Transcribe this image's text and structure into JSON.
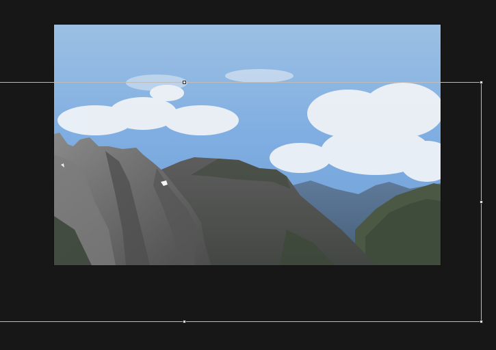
{
  "canvas": {
    "background": "#171717",
    "image": {
      "subject": "mountain-landscape",
      "sky_top": "#9cc0e3",
      "sky_bottom": "#6f9fd6",
      "rock_color": "#6e6e6e",
      "forest_color": "#3b4a37"
    }
  },
  "transform_box": {
    "line_color": "#bdbdbd",
    "handle_color": "#e6e6e6",
    "handles": [
      "top-center",
      "top-right",
      "middle-right",
      "bottom-center",
      "bottom-right"
    ]
  }
}
